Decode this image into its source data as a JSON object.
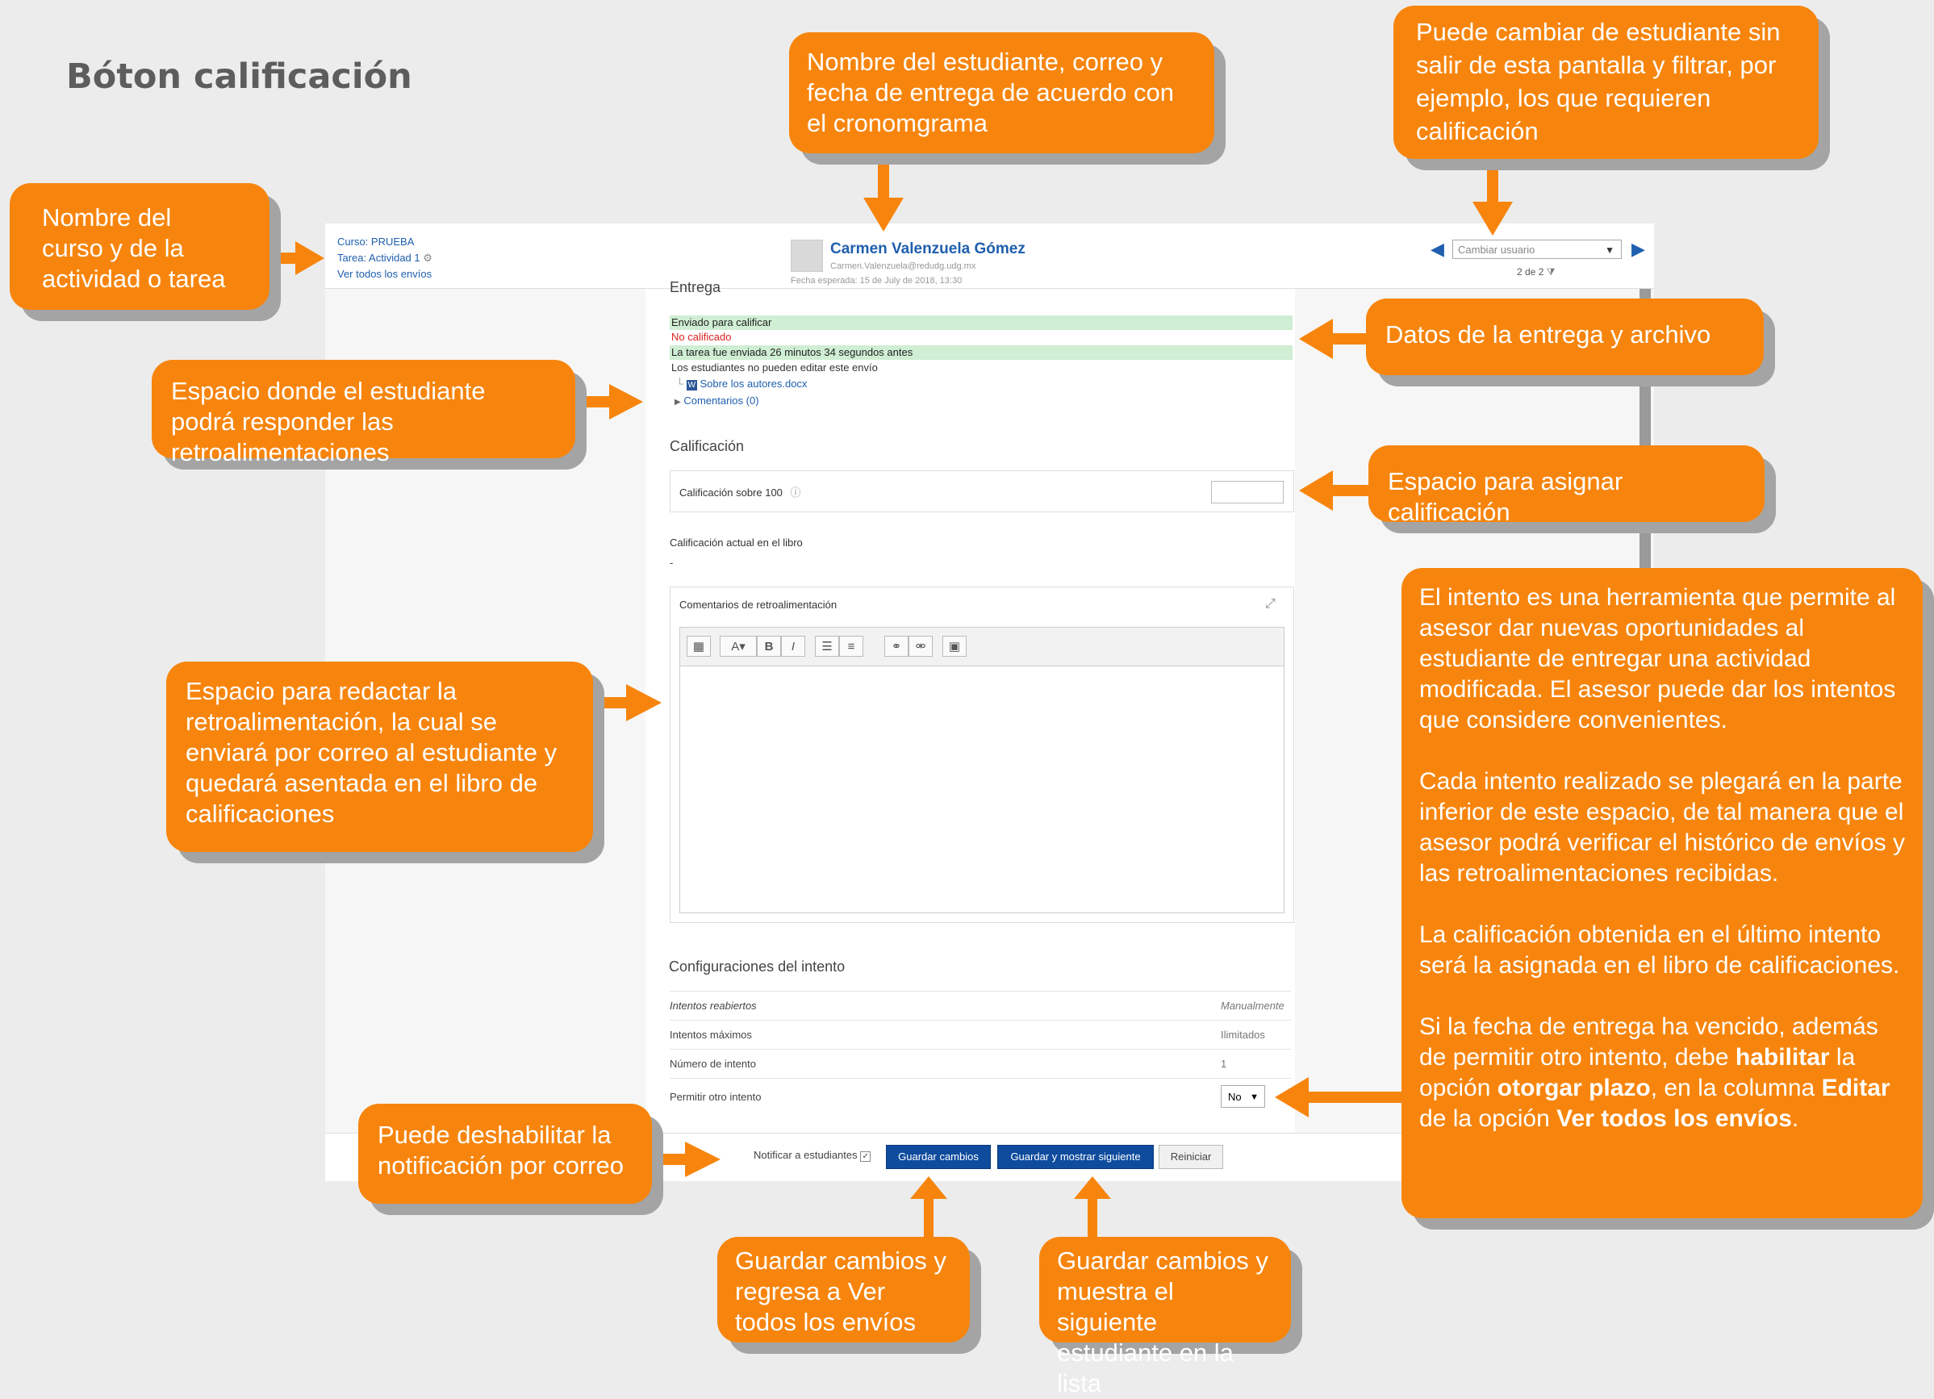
{
  "page": {
    "title": "Bóton calificación"
  },
  "header": {
    "course": "Curso: PRUEBA",
    "task": "Tarea: Actividad 1",
    "view_all": "Ver todos los envíos",
    "student_name": "Carmen Valenzuela Gómez",
    "student_email": "Carmen.Valenzuela@redudg.udg.mx",
    "due_date": "Fecha esperada: 15 de July de 2018, 13:30",
    "change_user_placeholder": "Cambiar usuario",
    "pager": "2 de 2"
  },
  "submission": {
    "heading": "Entrega",
    "status_submitted": "Enviado para calificar",
    "status_grading": "No calificado",
    "time_status": "La tarea fue enviada 26 minutos 34 segundos antes",
    "edit_status": "Los estudiantes no pueden editar este envío",
    "file_name": "Sobre los autores.docx",
    "comments": "Comentarios (0)"
  },
  "grade": {
    "heading": "Calificación",
    "label": "Calificación sobre 100",
    "current_label": "Calificación actual en el libro",
    "current_value": "-"
  },
  "feedback": {
    "label": "Comentarios de retroalimentación"
  },
  "attempt_settings": {
    "heading": "Configuraciones del intento",
    "rows": [
      {
        "label": "Intentos reabiertos",
        "value": "Manualmente"
      },
      {
        "label": "Intentos máximos",
        "value": "Ilimitados"
      },
      {
        "label": "Número de intento",
        "value": "1"
      }
    ],
    "allow_label": "Permitir otro intento",
    "allow_value": "No"
  },
  "footer": {
    "notify_label": "Notificar a estudiantes",
    "save_label": "Guardar cambios",
    "save_next_label": "Guardar y mostrar siguiente",
    "reset_label": "Reiniciar"
  },
  "callouts": {
    "course_name": "Nombre del curso y de la actividad o tarea",
    "student_info": "Nombre del estudiante, correo y fecha de entrega de acuerdo con el cronomgrama",
    "change_student": "Puede cambiar de estudiante sin salir de esta pantalla y filtrar, por ejemplo, los que requieren calificación",
    "reply_space": "Espacio donde el estudiante podrá responder las retroalimentaciones",
    "submission_data": "Datos de la entrega y archivo",
    "grade_space": "Espacio para asignar calificación",
    "feedback_space": "Espacio para redactar la retroalimentación, la cual se enviará por correo al estudiante y quedará asentada en el libro de calificaciones",
    "attempt_p1": "El intento es una herramienta que permite al asesor dar nuevas oportunidades al estudiante de entregar una actividad modificada. El asesor puede dar los intentos que considere convenientes.",
    "attempt_p2": "Cada intento realizado se plegará en la parte inferior de este espacio, de tal manera que el asesor podrá verificar el histórico de envíos y las retroalimentaciones recibidas.",
    "attempt_p3": "La calificación obtenida en el último intento será la asignada en el libro de calificaciones.",
    "attempt_p4_a": "Si la fecha de entrega ha vencido, además de permitir otro intento, debe ",
    "attempt_p4_b": "habilitar",
    "attempt_p4_c": " la opción ",
    "attempt_p4_d": "otorgar plazo",
    "attempt_p4_e": ", en la columna ",
    "attempt_p4_f": "Editar",
    "attempt_p4_g": " de la opción ",
    "attempt_p4_h": "Ver todos los envíos",
    "attempt_p4_i": ".",
    "notify_disable": "Puede deshabilitar la notificación por correo",
    "save_return": "Guardar cambios y regresa a Ver todos los envíos",
    "save_next": "Guardar cambios y muestra el siguiente estudiante en la lista"
  },
  "colors": {
    "callout": "#f7850d",
    "primary_button": "#0f4c9e",
    "link": "#1f5fae"
  }
}
